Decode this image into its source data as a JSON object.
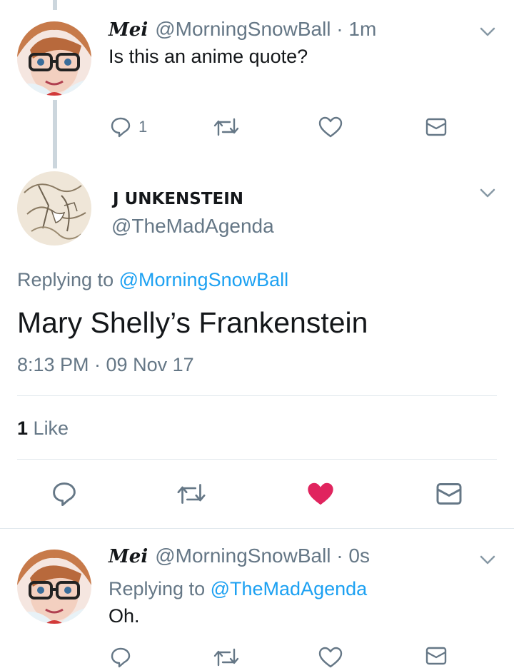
{
  "tweet1": {
    "display_name": "Mei",
    "handle": "@MorningSnowBall",
    "time": "· 1m",
    "text": "Is this an anime quote?",
    "reply_count": "1"
  },
  "focused": {
    "display_name": "J UNKENSTEIN",
    "handle": "@TheMadAgenda",
    "replying_prefix": "Replying to",
    "replying_to": "@MorningSnowBall",
    "text": "Mary Shelly’s Frankenstein",
    "timestamp": "8:13 PM · 09 Nov 17",
    "likes_count": "1",
    "likes_label": "Like",
    "liked": true
  },
  "tweet2": {
    "display_name": "Mei",
    "handle": "@MorningSnowBall",
    "time": "· 0s",
    "replying_prefix": "Replying to",
    "replying_to": "@TheMadAgenda",
    "text": "Oh."
  },
  "colors": {
    "accent": "#1da1f2",
    "like_red": "#e0245e",
    "icon_gray": "#657786",
    "divider": "#e1e8ed",
    "thread_line": "#ccd6dd"
  }
}
